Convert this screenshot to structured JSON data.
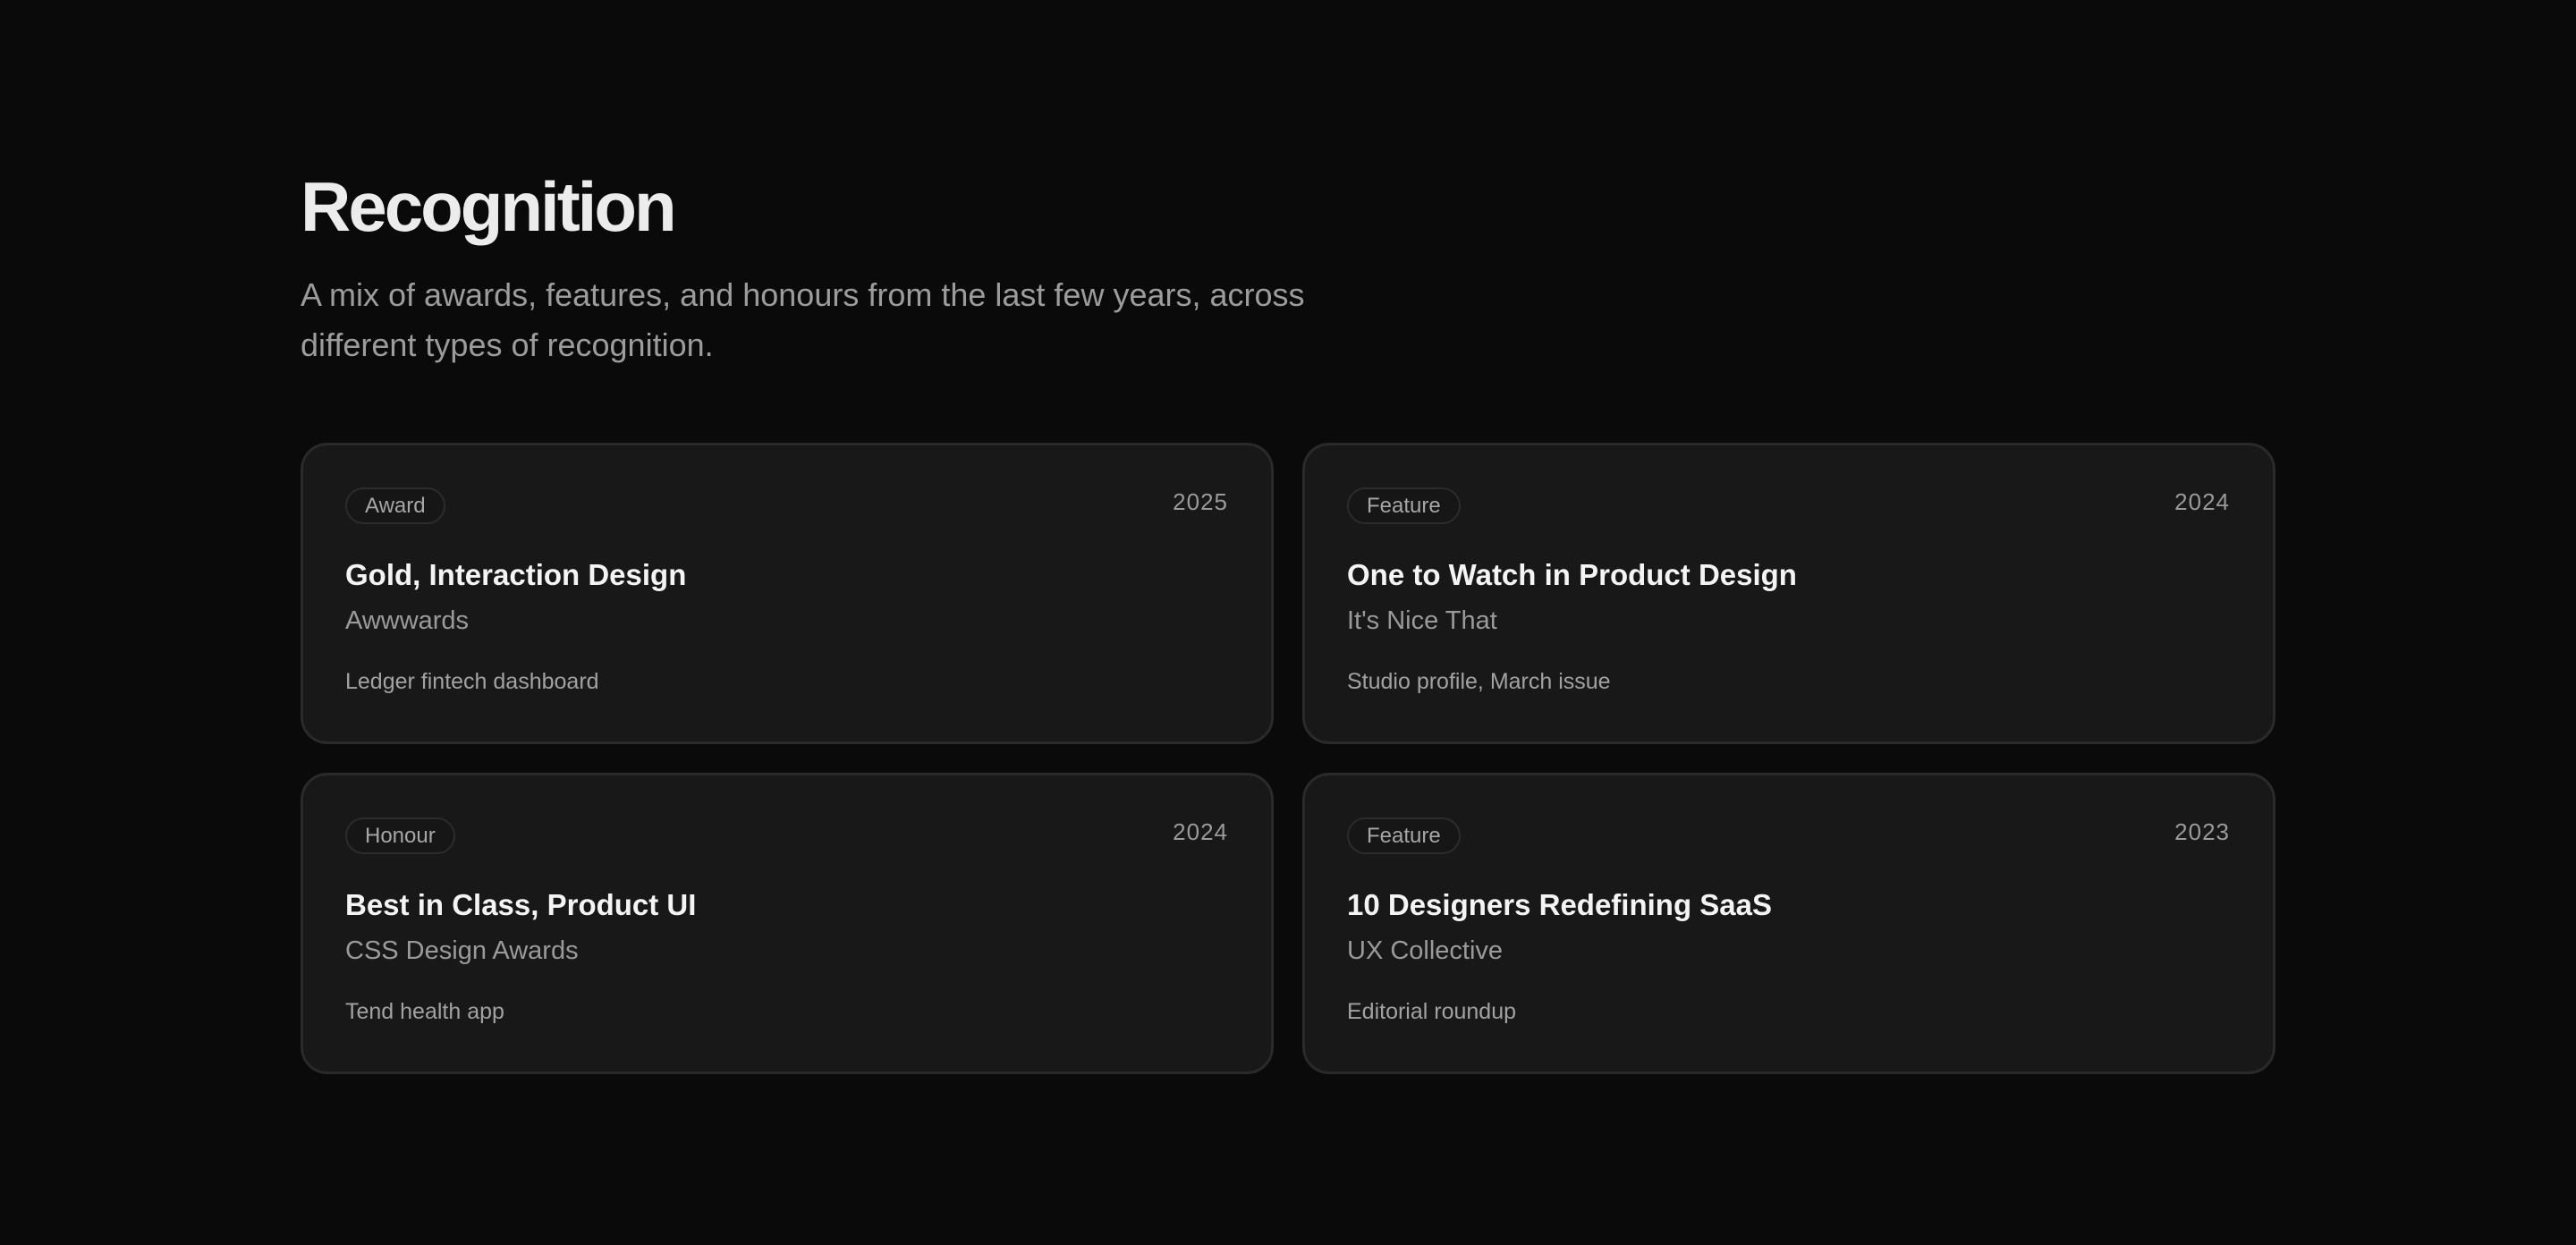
{
  "header": {
    "title": "Recognition",
    "subtitle": "A mix of awards, features, and honours from the last few years, across different types of recognition."
  },
  "cards": [
    {
      "tag": "Award",
      "year": "2025",
      "title": "Gold, Interaction Design",
      "source": "Awwwards",
      "description": "Ledger fintech dashboard"
    },
    {
      "tag": "Feature",
      "year": "2024",
      "title": "One to Watch in Product Design",
      "source": "It's Nice That",
      "description": "Studio profile, March issue"
    },
    {
      "tag": "Honour",
      "year": "2024",
      "title": "Best in Class, Product UI",
      "source": "CSS Design Awards",
      "description": "Tend health app"
    },
    {
      "tag": "Feature",
      "year": "2023",
      "title": "10 Designers Redefining SaaS",
      "source": "UX Collective",
      "description": "Editorial roundup"
    }
  ],
  "colors": {
    "background": "#0a0a0a",
    "card": "#181818",
    "card_border": "#2a2a2a",
    "text_primary": "#f4f4f4",
    "text_muted": "#9a9a9a"
  }
}
